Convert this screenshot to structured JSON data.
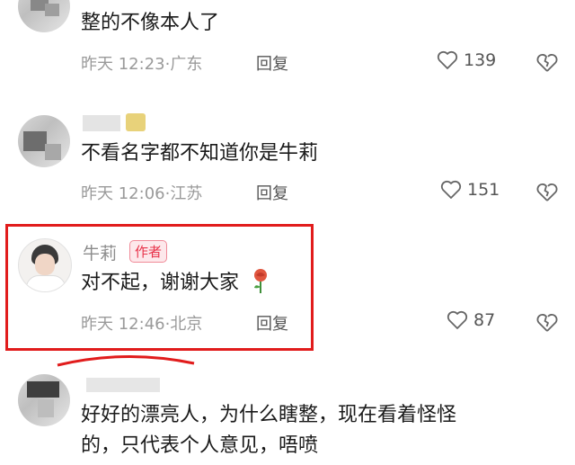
{
  "comments": [
    {
      "content": "整的不像本人了",
      "time": "昨天 12:23",
      "location": "广东",
      "reply": "回复",
      "likes": "139"
    },
    {
      "content": "不看名字都不知道你是牛莉",
      "time": "昨天 12:06",
      "location": "江苏",
      "reply": "回复",
      "likes": "151"
    },
    {
      "username": "牛莉",
      "badge": "作者",
      "content": "对不起，谢谢大家",
      "time": "昨天 12:46",
      "location": "北京",
      "reply": "回复",
      "likes": "87"
    },
    {
      "content_line1": "好好的漂亮人，为什么瞎整，现在看着怪怪",
      "content_line2": "的，只代表个人意见，唔喷"
    }
  ],
  "separator": "·",
  "colors": {
    "highlight": "#e11c1c",
    "badge_text": "#e8334a",
    "meta": "#9a9a9a"
  },
  "icons": {
    "like": "heart-outline-icon",
    "dislike": "broken-heart-icon",
    "rose": "rose-icon"
  }
}
